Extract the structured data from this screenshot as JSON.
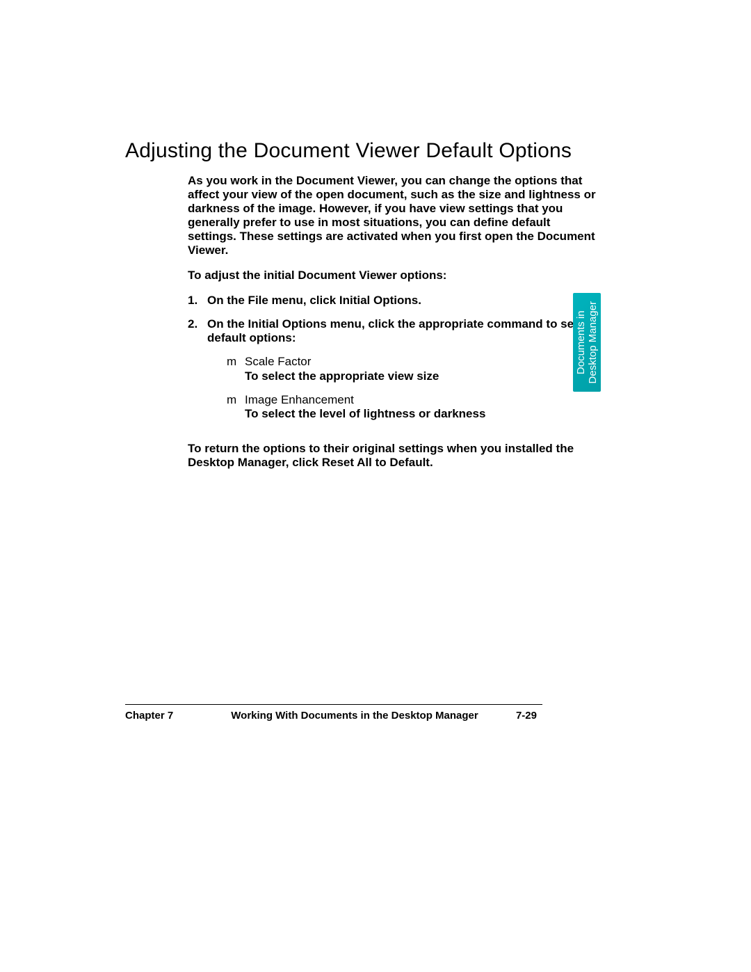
{
  "title": "Adjusting the Document Viewer Default Options",
  "intro": "As you work in the Document Viewer, you can change the options that affect your view of the open document, such as the size and lightness or darkness of the image. However, if you have view settings that you generally prefer to use in most situations, you can define default settings. These settings are activated when you first open the Document Viewer.",
  "lead": "To adjust the initial Document Viewer options:",
  "steps": {
    "s1_num": "1.",
    "s1_txt": "On the File menu, click Initial Options.",
    "s2_num": "2.",
    "s2_txt": "On the Initial Options menu, click the appropriate command to set default options:"
  },
  "subs": {
    "mark": "m",
    "a_name": "Scale Factor",
    "a_desc": "To select the appropriate view size",
    "b_name": "Image Enhancement",
    "b_desc": "To select the level of lightness or darkness"
  },
  "outro": "To return the options to their original settings when you installed the Desktop Manager, click Reset All to Default.",
  "tab": {
    "line1": "Documents in",
    "line2": "Desktop Manager"
  },
  "footer": {
    "left": "Chapter 7",
    "center": "Working With Documents in the Desktop Manager",
    "page": "7-29"
  }
}
